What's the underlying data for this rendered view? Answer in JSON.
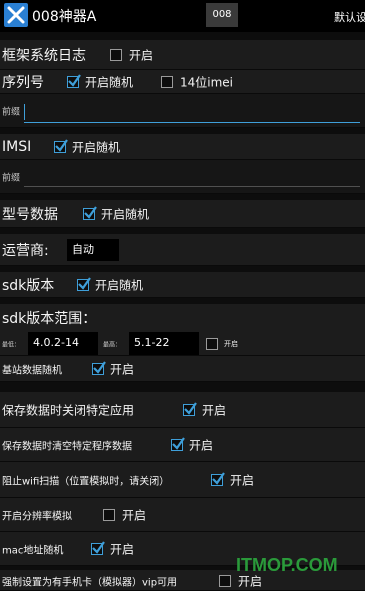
{
  "app": {
    "title": "008神器A",
    "tab_label": "008",
    "settings_label": "默认设"
  },
  "rows": {
    "framework_log": {
      "label": "框架系统日志",
      "option": "开启",
      "checked": false
    },
    "serial": {
      "label": "序列号",
      "option_random": "开启随机",
      "random_checked": true,
      "option_imei": "14位imei",
      "imei_checked": false
    },
    "serial_prefix": {
      "label": "前缀",
      "value": ""
    },
    "imsi": {
      "label": "IMSI",
      "option": "开启随机",
      "checked": true
    },
    "imsi_prefix": {
      "label": "前缀",
      "value": ""
    },
    "model": {
      "label": "型号数据",
      "option": "开启随机",
      "checked": true
    },
    "carrier": {
      "label": "运营商:",
      "value": "自动"
    },
    "sdk": {
      "label": "sdk版本",
      "option": "开启随机",
      "checked": true
    },
    "sdk_range": {
      "label": "sdk版本范围：",
      "min_label": "最低：",
      "min_value": "4.0.2-14",
      "max_label": "最高：",
      "max_value": "5.1-22",
      "option": "开启",
      "checked": false
    },
    "base_station": {
      "label": "基站数据随机",
      "option": "开启",
      "checked": true
    },
    "save_close": {
      "label": "保存数据时关闭特定应用",
      "option": "开启",
      "checked": true
    },
    "save_clear": {
      "label": "保存数据时清空特定程序数据",
      "option": "开启",
      "checked": true
    },
    "block_wifi": {
      "label": "阻止wifi扫描（位置模拟时，请关闭）",
      "option": "开启",
      "checked": true
    },
    "resolution": {
      "label": "开启分辨率模拟",
      "option": "开启",
      "checked": false
    },
    "mac": {
      "label": "mac地址随机",
      "option": "开启",
      "checked": true
    },
    "sim": {
      "label": "强制设置为有手机卡（模拟器）vip可用",
      "option": "开启",
      "checked": false
    }
  },
  "watermark": "ITMOP.COM",
  "colors": {
    "accent": "#3f9fd9",
    "row_bg": "#1c1c1c",
    "watermark": "#2a9a3a"
  }
}
